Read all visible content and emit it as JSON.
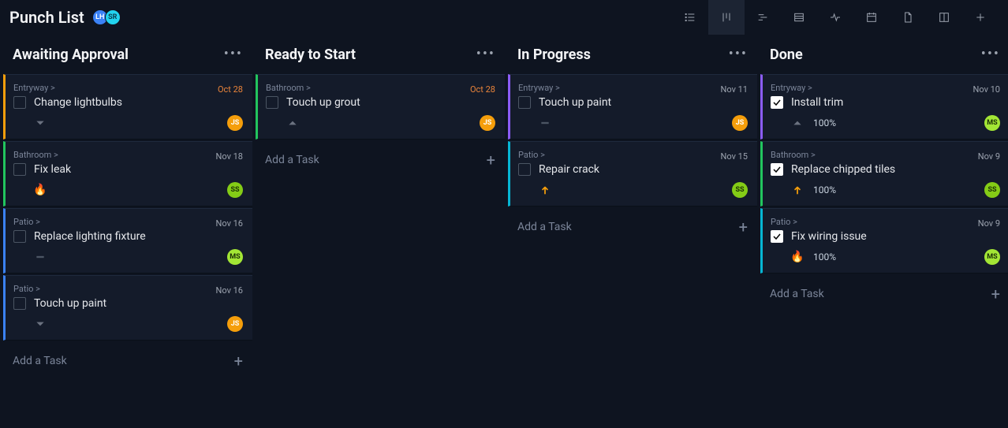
{
  "header": {
    "title": "Punch List",
    "avatars": [
      {
        "initials": "LH",
        "colorClass": "av-blue"
      },
      {
        "initials": "SR",
        "colorClass": "av-cyan"
      }
    ],
    "views": [
      "list",
      "board",
      "timeline",
      "table",
      "activity",
      "calendar",
      "files",
      "dashboard",
      "add"
    ],
    "activeView": "board"
  },
  "addTaskLabel": "Add a Task",
  "columnMenuGlyph": "•••",
  "columns": [
    {
      "id": "awaiting",
      "title": "Awaiting Approval",
      "cards": [
        {
          "stripe": "s-orange",
          "checked": false,
          "crumb": "Entryway >",
          "title": "Change lightbulbs",
          "due": "Oct 28",
          "overdue": true,
          "priority": "low",
          "progress": "",
          "assignee": {
            "initials": "JS",
            "colorClass": "av-orange"
          }
        },
        {
          "stripe": "s-green",
          "checked": false,
          "crumb": "Bathroom >",
          "title": "Fix leak",
          "due": "Nov 18",
          "overdue": false,
          "priority": "highest",
          "progress": "",
          "assignee": {
            "initials": "SS",
            "colorClass": "av-green"
          }
        },
        {
          "stripe": "s-blue",
          "checked": false,
          "crumb": "Patio >",
          "title": "Replace lighting fixture",
          "due": "Nov 16",
          "overdue": false,
          "priority": "lowest",
          "progress": "",
          "assignee": {
            "initials": "MS",
            "colorClass": "av-lime"
          }
        },
        {
          "stripe": "s-blue",
          "checked": false,
          "crumb": "Patio >",
          "title": "Touch up paint",
          "due": "Nov 16",
          "overdue": false,
          "priority": "low",
          "progress": "",
          "assignee": {
            "initials": "JS",
            "colorClass": "av-orange"
          }
        }
      ]
    },
    {
      "id": "ready",
      "title": "Ready to Start",
      "cards": [
        {
          "stripe": "s-green",
          "checked": false,
          "crumb": "Bathroom >",
          "title": "Touch up grout",
          "due": "Oct 28",
          "overdue": true,
          "priority": "medium",
          "progress": "",
          "assignee": {
            "initials": "JS",
            "colorClass": "av-orange"
          }
        }
      ]
    },
    {
      "id": "inprogress",
      "title": "In Progress",
      "cards": [
        {
          "stripe": "s-purple",
          "checked": false,
          "crumb": "Entryway >",
          "title": "Touch up paint",
          "due": "Nov 11",
          "overdue": false,
          "priority": "lowest",
          "progress": "",
          "assignee": {
            "initials": "JS",
            "colorClass": "av-orange"
          }
        },
        {
          "stripe": "s-cyan",
          "checked": false,
          "crumb": "Patio >",
          "title": "Repair crack",
          "due": "Nov 15",
          "overdue": false,
          "priority": "high",
          "progress": "",
          "assignee": {
            "initials": "SS",
            "colorClass": "av-green"
          }
        }
      ]
    },
    {
      "id": "done",
      "title": "Done",
      "cards": [
        {
          "stripe": "s-purple",
          "checked": true,
          "crumb": "Entryway >",
          "title": "Install trim",
          "due": "Nov 10",
          "overdue": false,
          "priority": "medium",
          "progress": "100%",
          "assignee": {
            "initials": "MS",
            "colorClass": "av-lime"
          }
        },
        {
          "stripe": "s-green",
          "checked": true,
          "crumb": "Bathroom >",
          "title": "Replace chipped tiles",
          "due": "Nov 9",
          "overdue": false,
          "priority": "high",
          "progress": "100%",
          "assignee": {
            "initials": "SS",
            "colorClass": "av-green"
          }
        },
        {
          "stripe": "s-cyan",
          "checked": true,
          "crumb": "Patio >",
          "title": "Fix wiring issue",
          "due": "Nov 9",
          "overdue": false,
          "priority": "highest",
          "progress": "100%",
          "assignee": {
            "initials": "MS",
            "colorClass": "av-lime"
          }
        }
      ]
    }
  ]
}
